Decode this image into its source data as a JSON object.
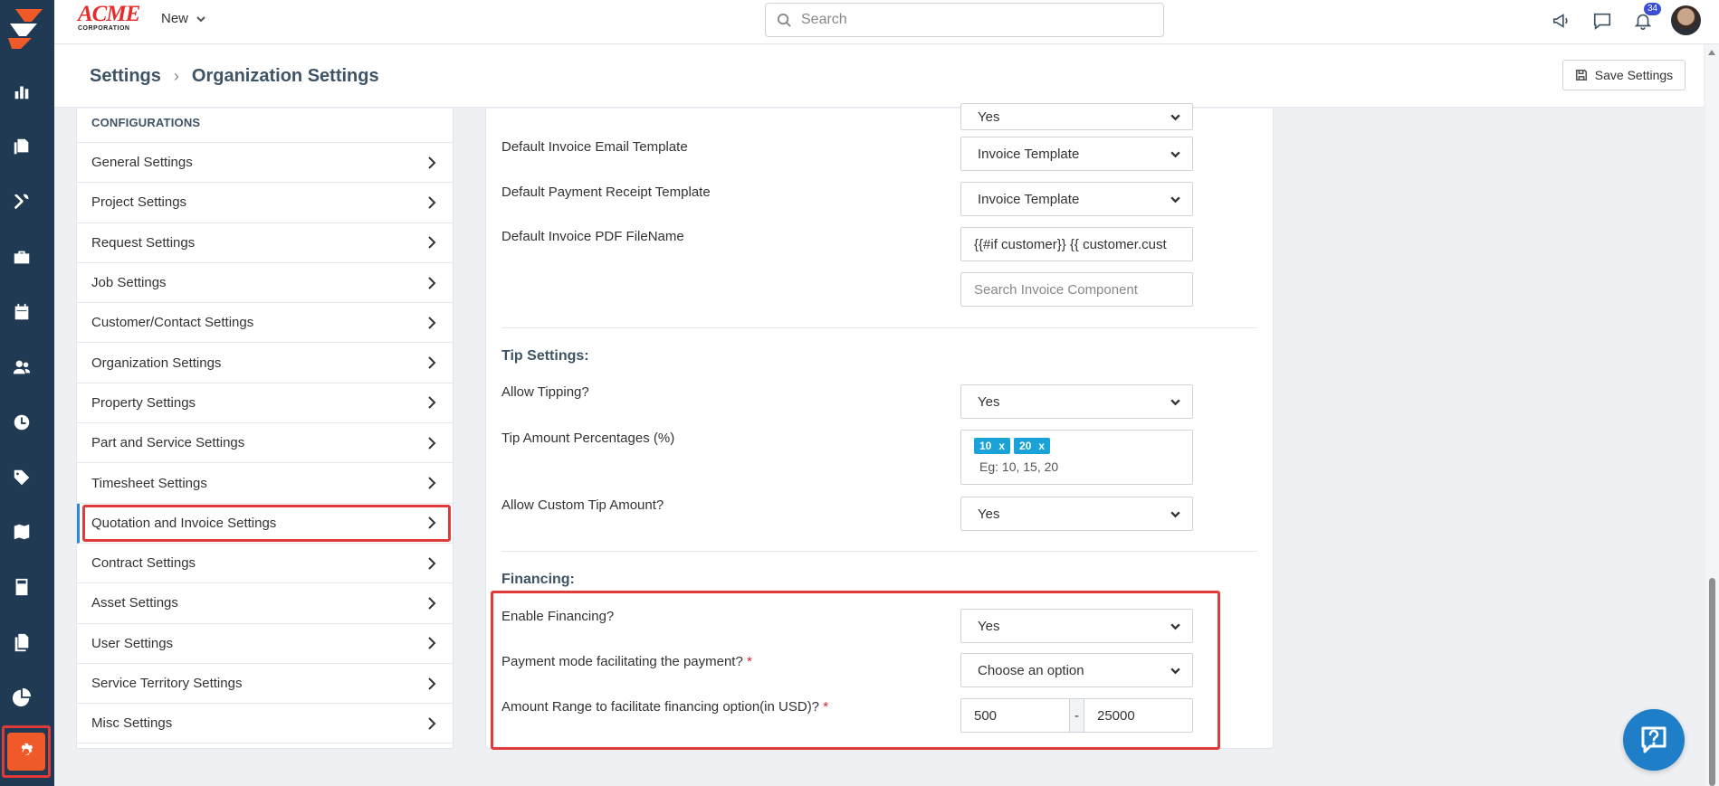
{
  "brand": {
    "name": "ACME",
    "sub": "CORPORATION"
  },
  "topbar": {
    "new_label": "New",
    "search_placeholder": "Search",
    "notification_count": "34"
  },
  "breadcrumb": {
    "root": "Settings",
    "current": "Organization Settings"
  },
  "save_label": "Save Settings",
  "config": {
    "header": "CONFIGURATIONS",
    "items": [
      "General Settings",
      "Project Settings",
      "Request Settings",
      "Job Settings",
      "Customer/Contact Settings",
      "Organization Settings",
      "Property Settings",
      "Part and Service Settings",
      "Timesheet Settings",
      "Quotation and Invoice Settings",
      "Contract Settings",
      "Asset Settings",
      "User Settings",
      "Service Territory Settings",
      "Misc Settings"
    ],
    "active_index": 9
  },
  "invoice": {
    "top_partial_value": "Yes",
    "email_template_label": "Default Invoice Email Template",
    "email_template_value": "Invoice Template",
    "receipt_template_label": "Default Payment Receipt Template",
    "receipt_template_value": "Invoice Template",
    "pdf_filename_label": "Default Invoice PDF FileName",
    "pdf_filename_value": "{{#if customer}} {{ customer.cust",
    "component_search_placeholder": "Search Invoice Component"
  },
  "tip": {
    "title": "Tip Settings:",
    "allow_label": "Allow Tipping?",
    "allow_value": "Yes",
    "percent_label": "Tip Amount Percentages (%)",
    "percent_tags": [
      "10",
      "20"
    ],
    "tag_remove": "x",
    "percent_placeholder": "Eg: 10, 15, 20",
    "custom_label": "Allow Custom Tip Amount?",
    "custom_value": "Yes"
  },
  "financing": {
    "title": "Financing:",
    "enable_label": "Enable Financing?",
    "enable_value": "Yes",
    "mode_label": "Payment mode facilitating the payment?",
    "mode_value": "Choose an option",
    "range_label": "Amount Range to facilitate financing option(in USD)?",
    "range_min": "500",
    "range_sep": "-",
    "range_max": "25000",
    "required_mark": "*"
  },
  "colors": {
    "rail": "#1f3a52",
    "accent": "#f05a28",
    "highlight": "#e03a3a",
    "tag": "#1aa3d9",
    "fab": "#1e7fc8"
  }
}
